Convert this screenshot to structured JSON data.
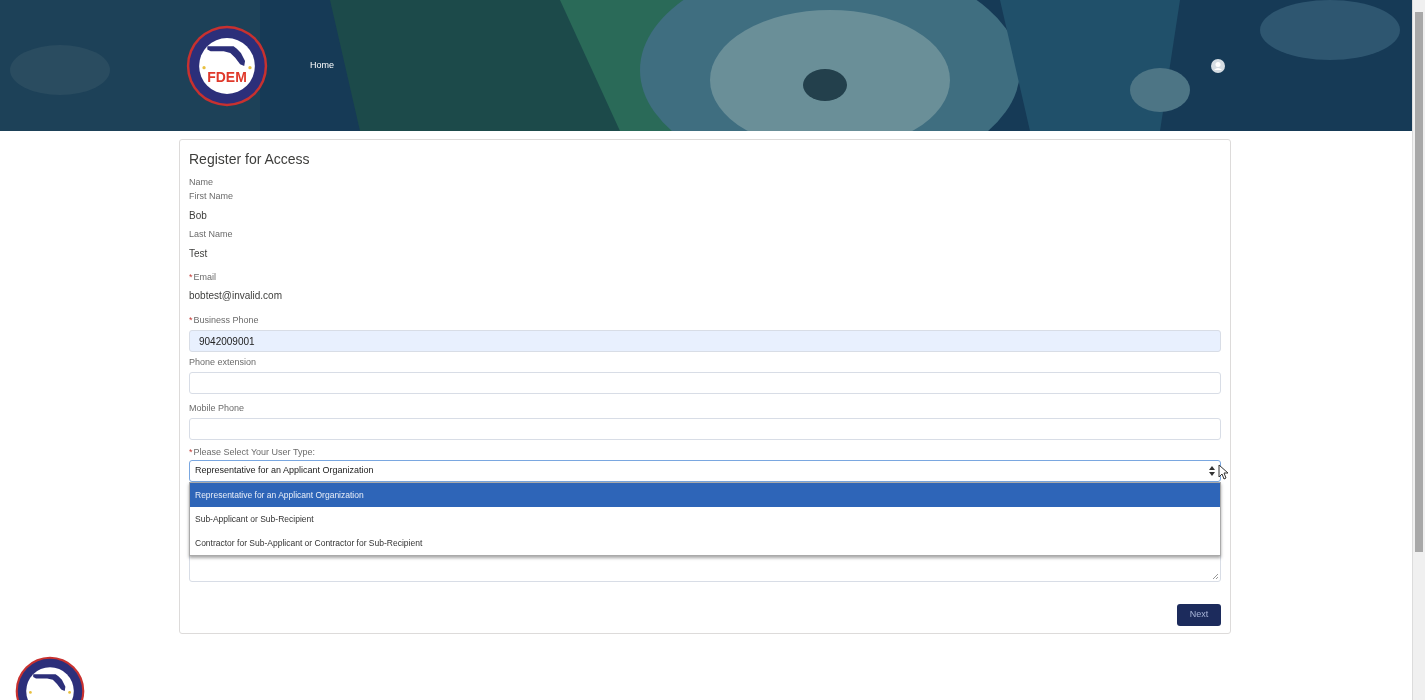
{
  "header": {
    "logo_text": "FDEM",
    "nav": [
      {
        "label": "Home"
      }
    ]
  },
  "form": {
    "title": "Register for Access",
    "group_label": "Name",
    "fields": [
      {
        "kind": "static",
        "label": "First Name",
        "value": "Bob"
      },
      {
        "kind": "static",
        "label": "Last Name",
        "value": "Test"
      },
      {
        "kind": "static",
        "label": "Email",
        "required_mark": "*",
        "value": "bobtest@invalid.com"
      },
      {
        "kind": "input",
        "label": "Business Phone",
        "required_mark": "*",
        "value": "9042009001",
        "autofilled": true
      },
      {
        "kind": "input",
        "label": "Phone extension",
        "autofilled": false
      },
      {
        "kind": "input",
        "label": "Mobile Phone",
        "autofilled": false
      },
      {
        "kind": "select",
        "label": "Please Select Your User Type:",
        "required_mark": "*",
        "value": "Representative for an Applicant Organization",
        "expanded": true,
        "options": [
          {
            "label": "Representative for an Applicant Organization",
            "selected": true
          },
          {
            "label": "Sub-Applicant or Sub-Recipient",
            "selected": false
          },
          {
            "label": "Contractor for Sub-Applicant or Contractor for Sub-Recipient",
            "selected": false
          }
        ]
      },
      {
        "kind": "textarea"
      }
    ],
    "submit": {
      "label": "Next"
    }
  }
}
